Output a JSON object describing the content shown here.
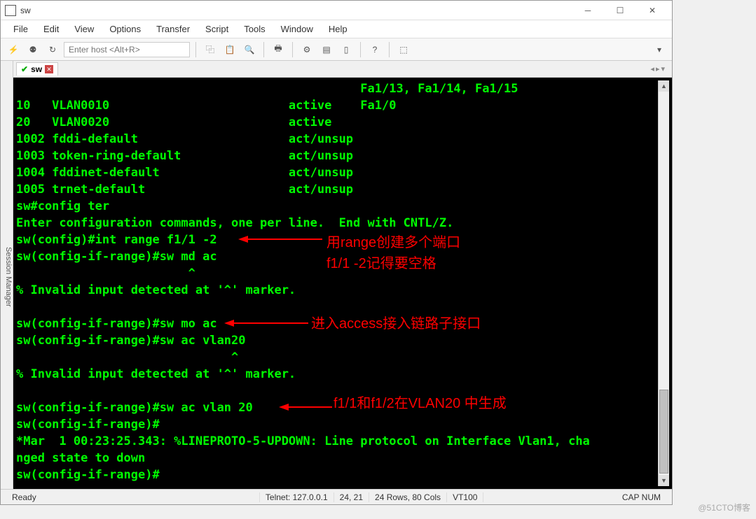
{
  "window": {
    "title": "sw"
  },
  "menubar": {
    "items": [
      "File",
      "Edit",
      "View",
      "Options",
      "Transfer",
      "Script",
      "Tools",
      "Window",
      "Help"
    ]
  },
  "toolbar": {
    "host_placeholder": "Enter host <Alt+R>"
  },
  "sidepanel": {
    "label": "Session Manager"
  },
  "tabs": {
    "items": [
      {
        "name": "sw"
      }
    ]
  },
  "terminal": {
    "lines": [
      "                                                Fa1/13, Fa1/14, Fa1/15",
      "10   VLAN0010                         active    Fa1/0",
      "20   VLAN0020                         active",
      "1002 fddi-default                     act/unsup",
      "1003 token-ring-default               act/unsup",
      "1004 fddinet-default                  act/unsup",
      "1005 trnet-default                    act/unsup",
      "sw#config ter",
      "Enter configuration commands, one per line.  End with CNTL/Z.",
      "sw(config)#int range f1/1 -2",
      "sw(config-if-range)#sw md ac",
      "                        ^",
      "% Invalid input detected at '^' marker.",
      "",
      "sw(config-if-range)#sw mo ac",
      "sw(config-if-range)#sw ac vlan20",
      "                              ^",
      "% Invalid input detected at '^' marker.",
      "",
      "sw(config-if-range)#sw ac vlan 20",
      "sw(config-if-range)#",
      "*Mar  1 00:23:25.343: %LINEPROTO-5-UPDOWN: Line protocol on Interface Vlan1, cha",
      "nged state to down",
      "sw(config-if-range)#"
    ]
  },
  "statusbar": {
    "ready": "Ready",
    "conn": "Telnet: 127.0.0.1",
    "pos": "24,  21",
    "dim": "24 Rows, 80 Cols",
    "term": "VT100",
    "caps": "CAP NUM"
  },
  "annotations": {
    "a1_line1": "用range创建多个端口",
    "a1_line2": "f1/1 -2记得要空格",
    "a2": "进入access接入链路子接口",
    "a3": "f1/1和f1/2在VLAN20 中生成"
  },
  "watermark": "@51CTO博客"
}
